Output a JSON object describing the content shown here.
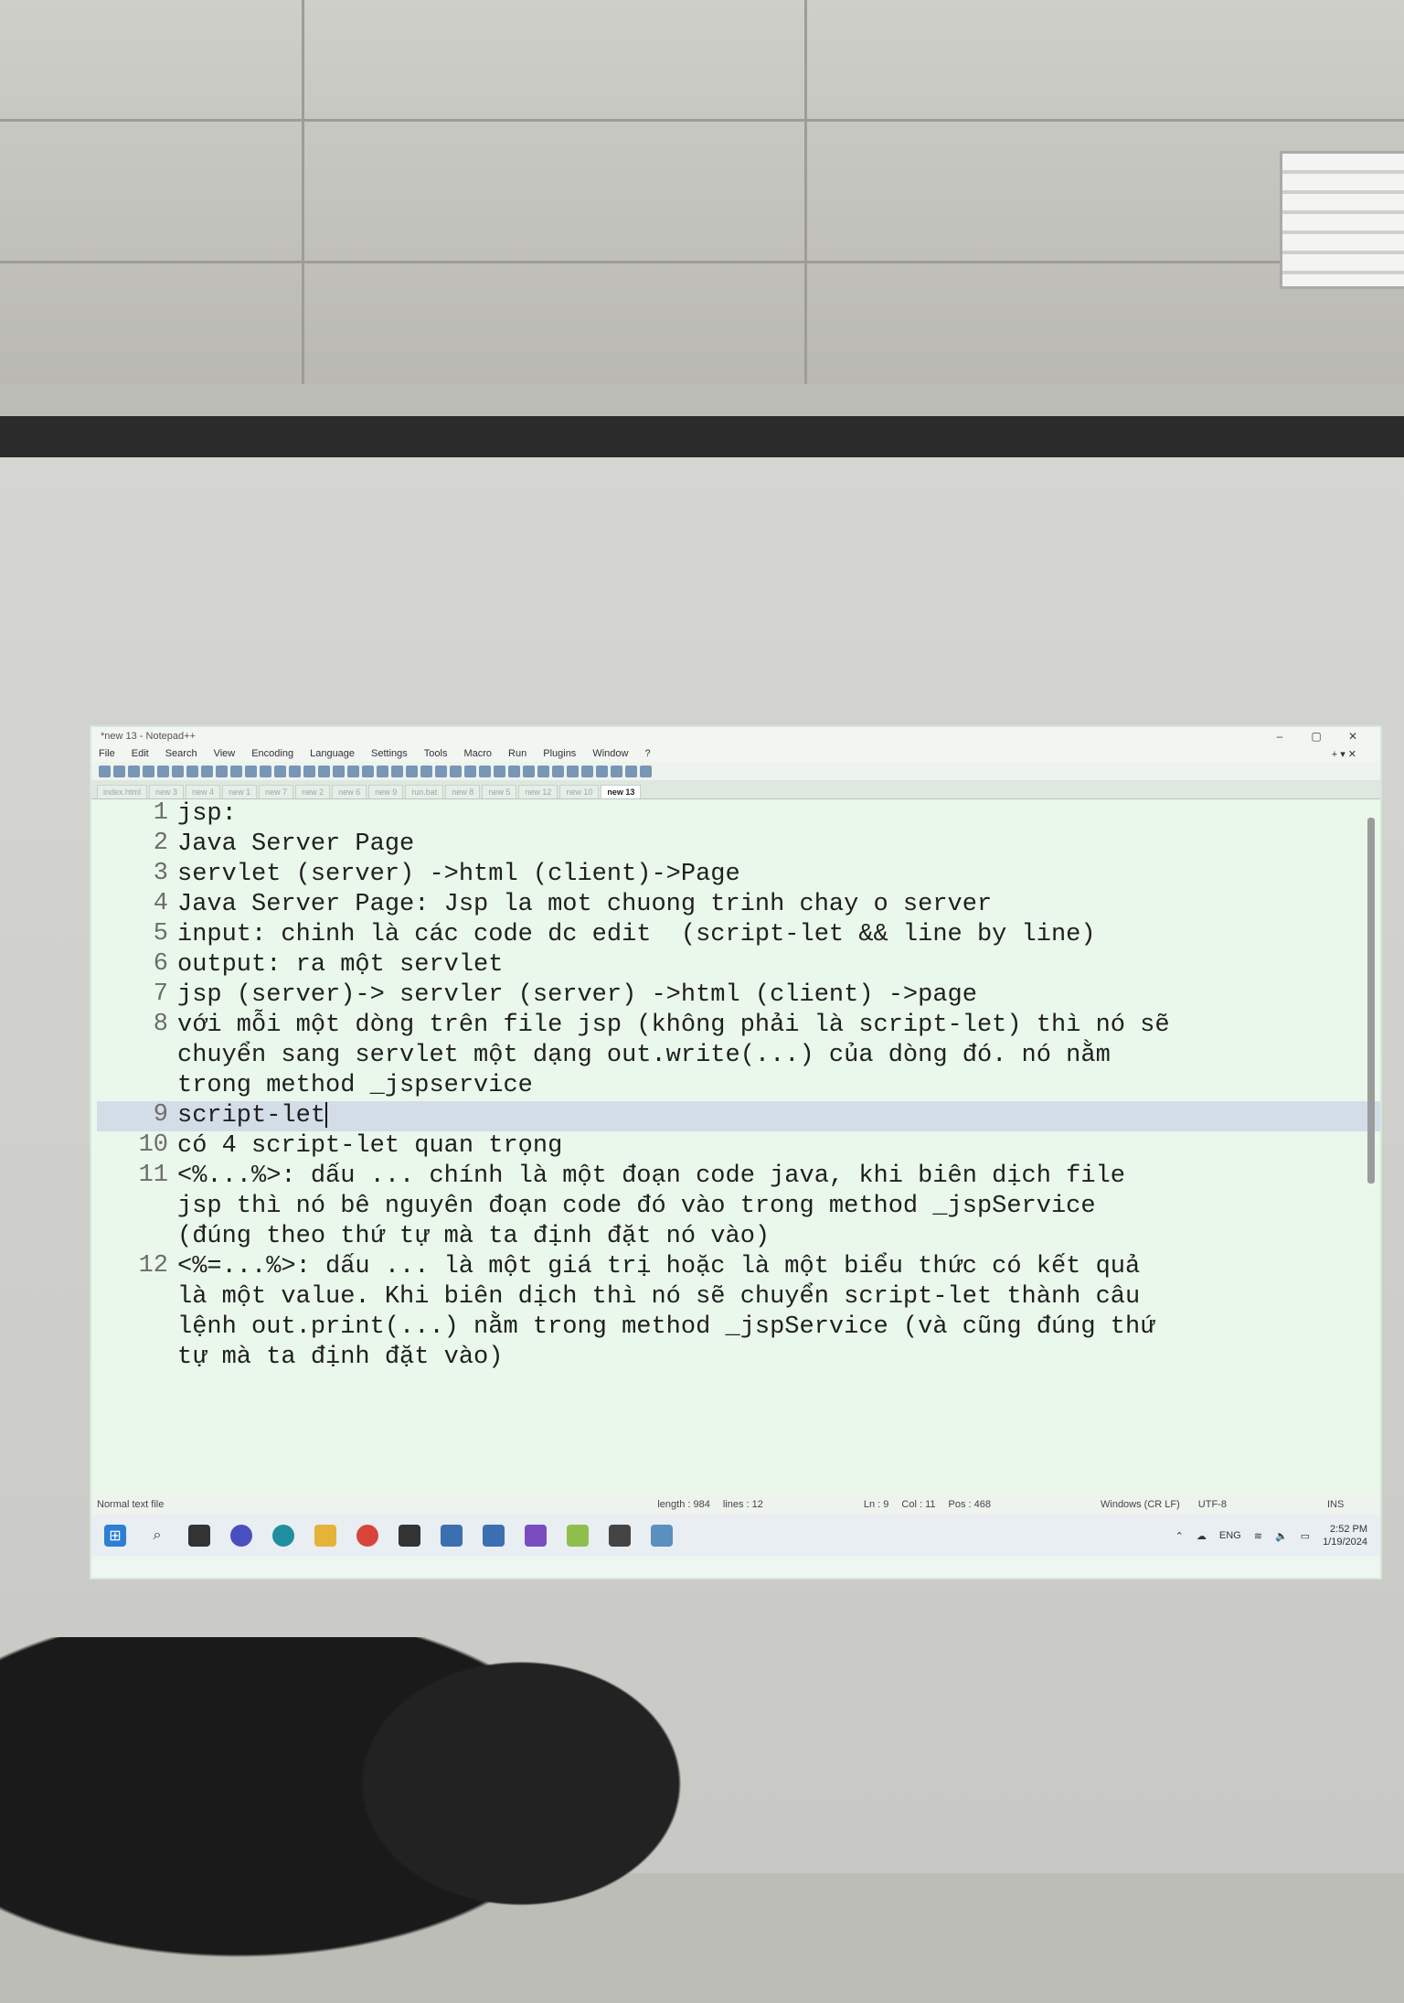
{
  "window": {
    "title": "*new 13 - Notepad++",
    "min": "–",
    "max": "▢",
    "close": "✕"
  },
  "menu": [
    "File",
    "Edit",
    "Search",
    "View",
    "Encoding",
    "Language",
    "Settings",
    "Tools",
    "Macro",
    "Run",
    "Plugins",
    "Window",
    "?"
  ],
  "menu_right": "+ ▾ ✕",
  "tabs": [
    "index.html",
    "new 3",
    "new 4",
    "new 1",
    "new 7",
    "new 2",
    "new 6",
    "new 9",
    "run.bat",
    "new 8",
    "new 5",
    "new 12",
    "new 10",
    "new 13"
  ],
  "active_tab": "new 13",
  "lines": [
    {
      "n": "1",
      "t": "jsp:"
    },
    {
      "n": "2",
      "t": "Java Server Page"
    },
    {
      "n": "3",
      "t": "servlet (server) ->html (client)->Page"
    },
    {
      "n": "4",
      "t": "Java Server Page: Jsp la mot chuong trinh chay o server"
    },
    {
      "n": "5",
      "t": "input: chinh là các code dc edit  (script-let && line by line)"
    },
    {
      "n": "6",
      "t": "output: ra một servlet"
    },
    {
      "n": "7",
      "t": "jsp (server)-> servler (server) ->html (client) ->page"
    },
    {
      "n": "8",
      "t": "với mỗi một dòng trên file jsp (không phải là script-let) thì nó sẽ\nchuyển sang servlet một dạng out.write(...) của dòng đó. nó nằm\ntrong method _jspservice"
    },
    {
      "n": "9",
      "t": "script-let"
    },
    {
      "n": "10",
      "t": "có 4 script-let quan trọng"
    },
    {
      "n": "11",
      "t": "<%...%>: dấu ... chính là một đoạn code java, khi biên dịch file\njsp thì nó bê nguyên đoạn code đó vào trong method _jspService\n(đúng theo thứ tự mà ta định đặt nó vào)"
    },
    {
      "n": "12",
      "t": "<%=...%>: dấu ... là một giá trị hoặc là một biểu thức có kết quả\nlà một value. Khi biên dịch thì nó sẽ chuyển script-let thành câu\nlệnh out.print(...) nằm trong method _jspService (và cũng đúng thứ\ntự mà ta định đặt vào)"
    }
  ],
  "current_line": "9",
  "status": {
    "type": "Normal text file",
    "length": "length : 984",
    "lines": "lines : 12",
    "ln": "Ln : 9",
    "col": "Col : 11",
    "pos": "Pos : 468",
    "eol": "Windows (CR LF)",
    "enc": "UTF-8",
    "ins": "INS"
  },
  "tray": {
    "lang": "ENG",
    "time": "2:52 PM",
    "date": "1/19/2024"
  },
  "colors": {
    "editor_bg": "#eaf8ec",
    "current_line": "#d3dde8"
  }
}
